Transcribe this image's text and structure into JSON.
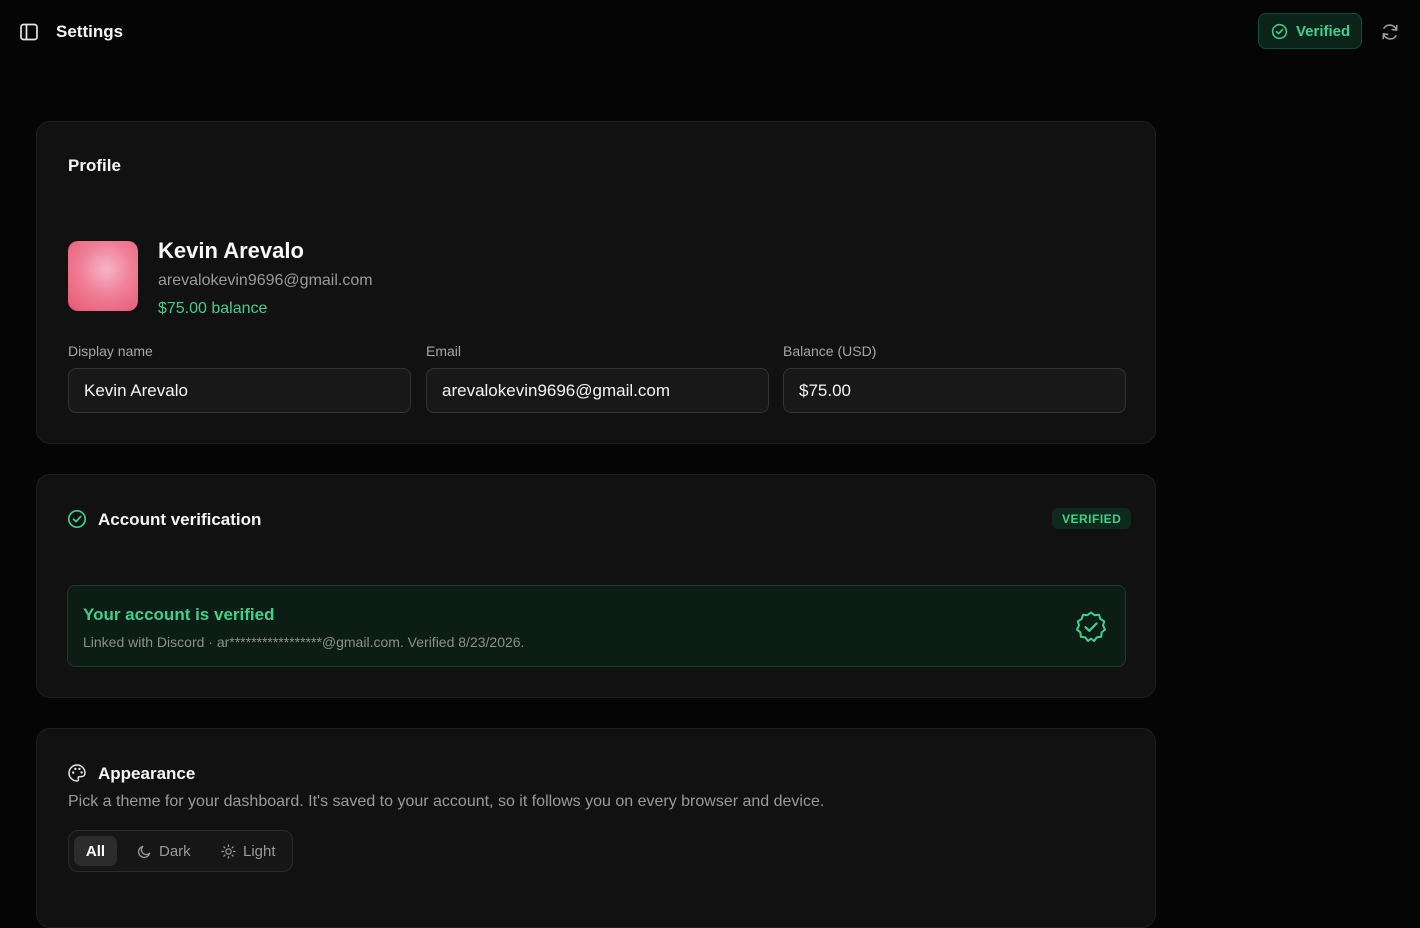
{
  "header": {
    "title": "Settings",
    "verified_label": "Verified",
    "sidebar_icon": "sidebar-toggle-icon",
    "refresh_icon": "refresh-icon"
  },
  "colors": {
    "accent_green": "#3fd08c",
    "background": "#050505",
    "card": "#111111"
  },
  "profile": {
    "section_title": "Profile",
    "name": "Kevin Arevalo",
    "email": "arevalokevin9696@gmail.com",
    "balance_text": "$75.00 balance",
    "fields": {
      "display_name_label": "Display name",
      "display_name_value": "Kevin Arevalo",
      "email_label": "Email",
      "email_value": "arevalokevin9696@gmail.com",
      "balance_label": "Balance (USD)",
      "balance_value": "$75.00"
    }
  },
  "verification": {
    "section_title": "Account verification",
    "badge": "VERIFIED",
    "status_title": "Your account is verified",
    "status_detail": "Linked with Discord · ar*****************@gmail.com. Verified 8/23/2026."
  },
  "appearance": {
    "section_title": "Appearance",
    "description": "Pick a theme for your dashboard. It's saved to your account, so it follows you on every browser and device.",
    "options": [
      {
        "label": "All",
        "selected": true
      },
      {
        "label": "Dark",
        "icon": "moon-icon",
        "selected": false
      },
      {
        "label": "Light",
        "icon": "sun-icon",
        "selected": false
      }
    ]
  }
}
